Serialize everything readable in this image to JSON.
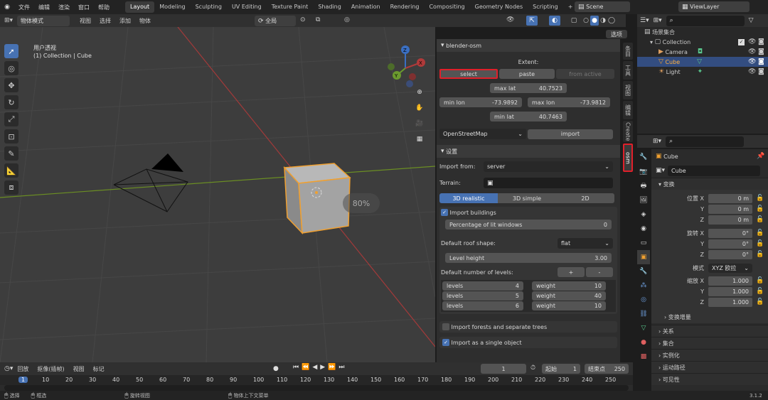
{
  "menu": [
    "文件",
    "编辑",
    "渲染",
    "窗口",
    "帮助"
  ],
  "workspaces": [
    "Layout",
    "Modeling",
    "Sculpting",
    "UV Editing",
    "Texture Paint",
    "Shading",
    "Animation",
    "Rendering",
    "Compositing",
    "Geometry Nodes",
    "Scripting"
  ],
  "scene": "Scene",
  "view_layer": "ViewLayer",
  "vp": {
    "mode": "物体模式",
    "menus": [
      "视图",
      "选择",
      "添加",
      "物体"
    ],
    "orientation": "全局",
    "options": "选项",
    "view_title": "用户透视",
    "collection_label": "(1) Collection | Cube",
    "zoom_overlay": "80%"
  },
  "osm": {
    "title": "blender-osm",
    "extent": "Extent:",
    "select": "select",
    "paste": "paste",
    "from_active": "from active",
    "max_lat_label": "max lat",
    "max_lat": "40.7523",
    "min_lon_label": "min lon",
    "min_lon": "-73.9892",
    "max_lon_label": "max lon",
    "max_lon": "-73.9812",
    "min_lat_label": "min lat",
    "min_lat": "40.7463",
    "source": "OpenStreetMap",
    "import": "import"
  },
  "settings": {
    "title": "设置",
    "import_from_label": "Import from:",
    "import_from": "server",
    "terrain_label": "Terrain:",
    "modes": [
      "3D realistic",
      "3D simple",
      "2D"
    ],
    "import_buildings": "Import buildings",
    "lit_windows_label": "Percentage of lit windows",
    "lit_windows": "0",
    "roof_label": "Default roof shape:",
    "roof": "flat",
    "level_height_label": "Level height",
    "level_height": "3.00",
    "levels_label": "Default number of levels:",
    "plus": "+",
    "minus": "-",
    "levels": [
      {
        "l": "levels",
        "v": "4",
        "w": "weight",
        "wv": "10"
      },
      {
        "l": "levels",
        "v": "5",
        "w": "weight",
        "wv": "40"
      },
      {
        "l": "levels",
        "v": "6",
        "w": "weight",
        "wv": "10"
      }
    ],
    "forests": "Import forests and separate trees",
    "single_object": "Import as a single object"
  },
  "side_tabs": [
    "条目",
    "工具",
    "视图",
    "编辑",
    "Create",
    "osm"
  ],
  "outliner": {
    "root": "场景集合",
    "collection": "Collection",
    "items": [
      "Camera",
      "Cube",
      "Light"
    ]
  },
  "props": {
    "object": "Cube",
    "data_name": "Cube",
    "transform": "变换",
    "loc_label": "位置 X",
    "y": "Y",
    "z": "Z",
    "rot_label": "旋转 X",
    "scale_label": "缩放 X",
    "loc": [
      "0 m",
      "0 m",
      "0 m"
    ],
    "rot": [
      "0°",
      "0°",
      "0°"
    ],
    "mode_label": "模式",
    "mode": "XYZ 欧拉",
    "scale": [
      "1.000",
      "1.000",
      "1.000"
    ],
    "delta": "变换增量",
    "sections": [
      "关系",
      "集合",
      "实例化",
      "运动路径",
      "可见性"
    ]
  },
  "timeline": {
    "menus": [
      "回放",
      "抠像(插帧)",
      "视图",
      "标记"
    ],
    "current": "1",
    "start_label": "起始",
    "start": "1",
    "end_label": "结束点",
    "end": "250",
    "ticks": [
      "1",
      "10",
      "20",
      "30",
      "40",
      "50",
      "60",
      "70",
      "80",
      "90",
      "100",
      "110",
      "120",
      "130",
      "140",
      "150",
      "160",
      "170",
      "180",
      "190",
      "200",
      "210",
      "220",
      "230",
      "240",
      "250"
    ]
  },
  "status": {
    "select": "选择",
    "box": "框选",
    "rotate": "旋转视图",
    "context": "物体上下文菜单",
    "version": "3.1.2"
  }
}
